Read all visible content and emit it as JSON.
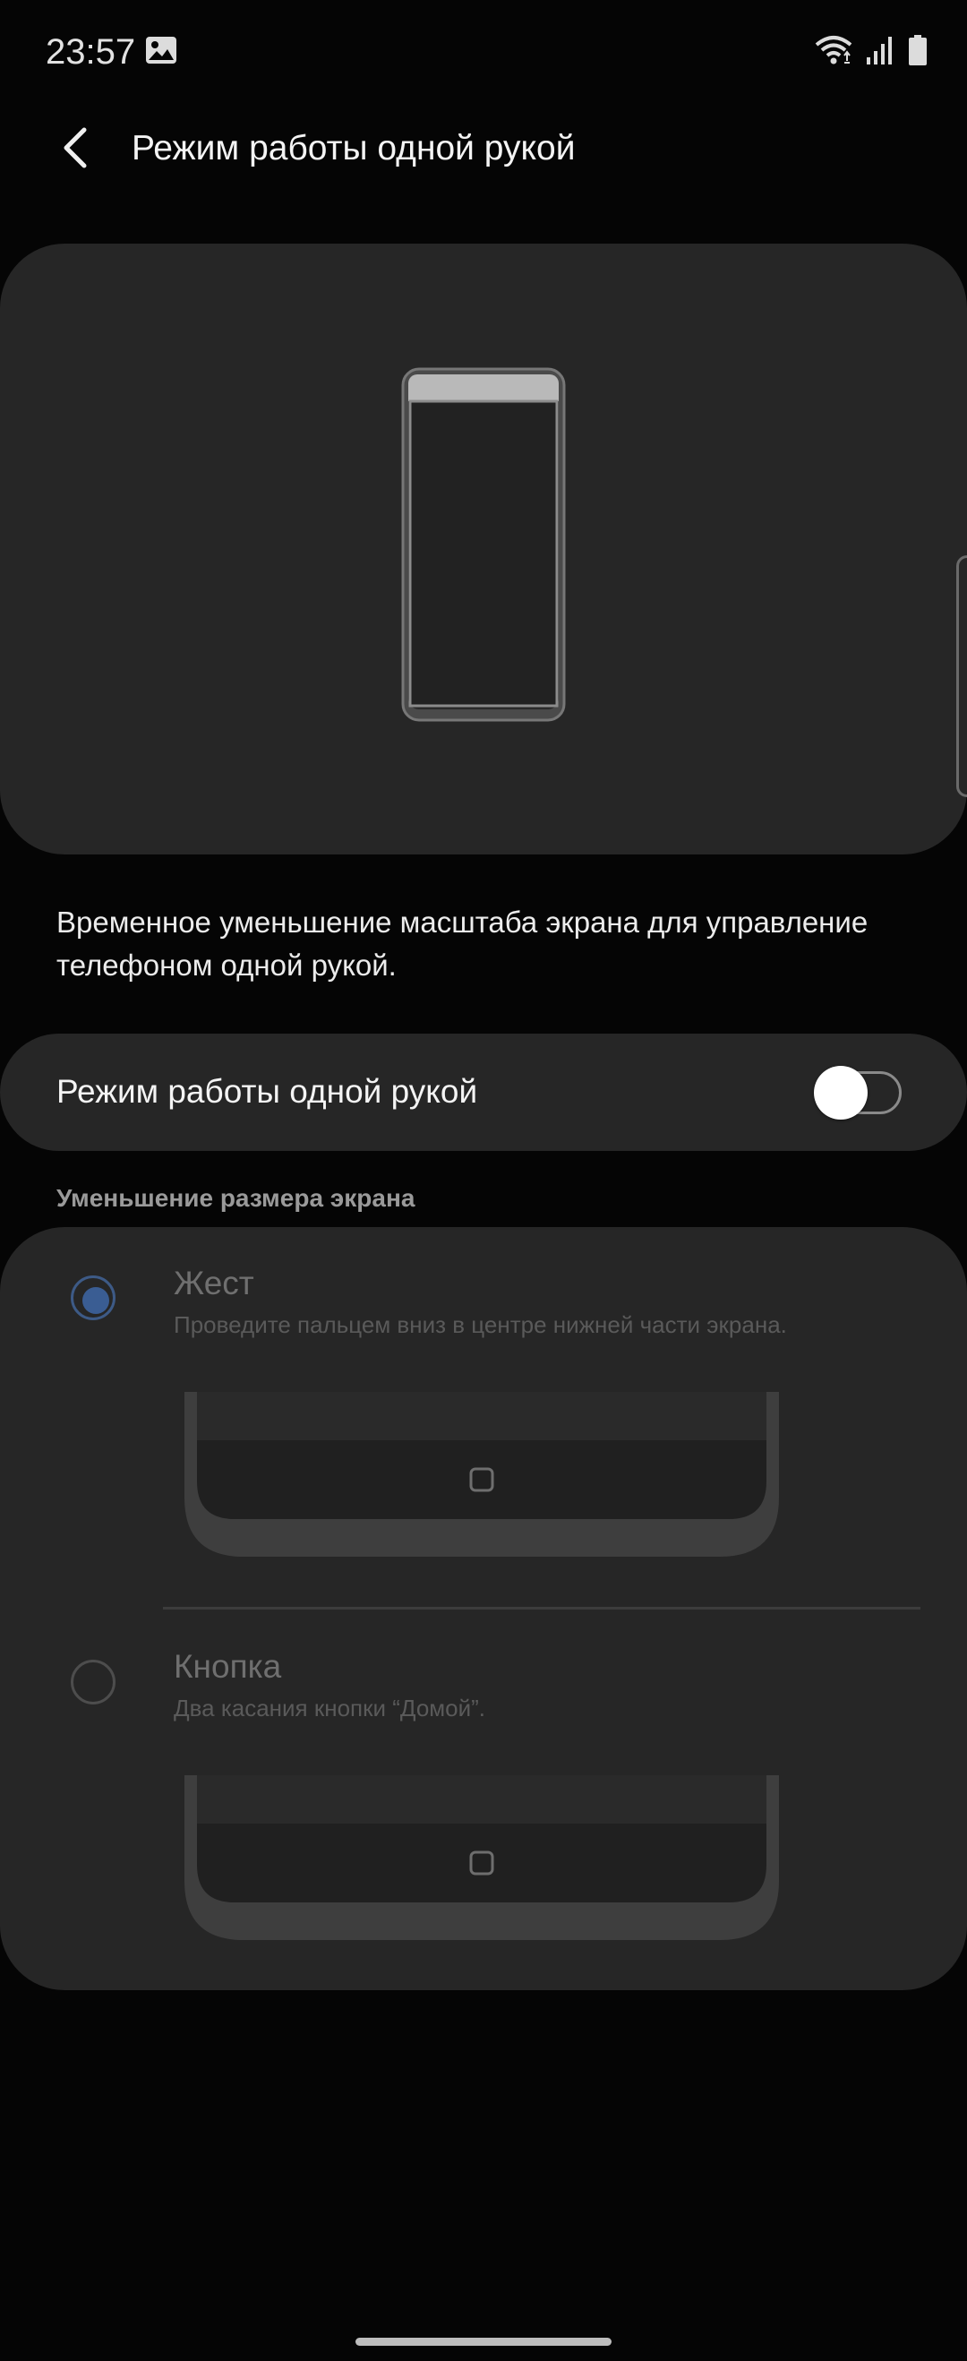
{
  "status_bar": {
    "time": "23:57",
    "left_icons": [
      "gallery-icon"
    ],
    "right_icons": [
      "wifi-icon",
      "signal-icon",
      "battery-icon"
    ]
  },
  "header": {
    "back_icon": "chevron-left-icon",
    "title": "Режим работы одной рукой"
  },
  "preview": {
    "illustration": "phone-outline"
  },
  "description": "Временное уменьшение масштаба экрана для управление телефоном одной рукой.",
  "toggle": {
    "label": "Режим работы одной рукой",
    "enabled": false
  },
  "section": {
    "header": "Уменьшение размера экрана",
    "options": [
      {
        "title": "Жест",
        "description": "Проведите пальцем вниз в центре нижней части экрана.",
        "selected": true
      },
      {
        "title": "Кнопка",
        "description": "Два касания кнопки “Домой”.",
        "selected": false
      }
    ]
  },
  "colors": {
    "background": "#050505",
    "card": "#262626",
    "accent": "#3a5d93",
    "text_primary": "#f4f4f4",
    "text_disabled": "#6f6f6f"
  }
}
